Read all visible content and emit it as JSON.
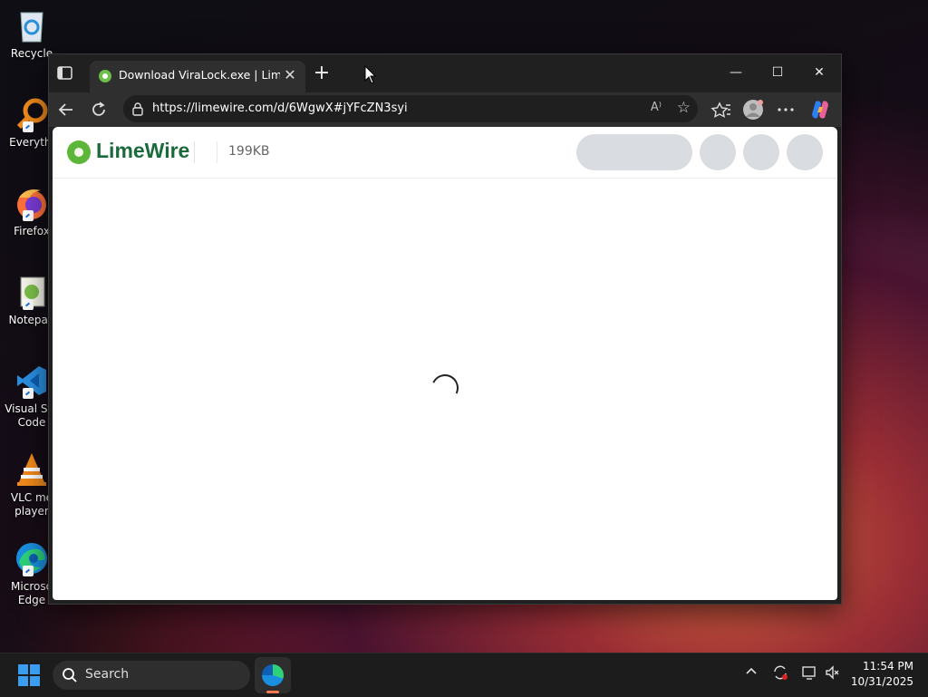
{
  "desktop": {
    "icons": [
      {
        "label": "Recycle",
        "icon": "recycle-bin-icon"
      },
      {
        "label": "Everythi",
        "icon": "everything-search-icon"
      },
      {
        "label": "Firefox",
        "icon": "firefox-icon"
      },
      {
        "label": "Notepad",
        "icon": "notepad-icon"
      },
      {
        "label": "Visual Stu\nCode",
        "label_line1": "Visual Stu",
        "label_line2": "Code",
        "icon": "vscode-icon"
      },
      {
        "label_line1": "VLC me",
        "label_line2": "player",
        "icon": "vlc-icon"
      },
      {
        "label_line1": "Microso",
        "label_line2": "Edge",
        "icon": "edge-icon"
      }
    ]
  },
  "browser": {
    "tab": {
      "title": "Download ViraLock.exe | LimeWire",
      "close": "✕"
    },
    "new_tab": "+",
    "window_controls": {
      "minimize": "—",
      "maximize": "☐",
      "close": "✕"
    },
    "address": {
      "url": "https://limewire.com/d/6WgwX#jYFcZN3syi"
    },
    "read_aloud": "A⁾",
    "favorite": "☆"
  },
  "page": {
    "logo_text": "LimeWire",
    "file_size": "199KB",
    "loading": true
  },
  "taskbar": {
    "search_placeholder": "Search",
    "time": "11:54 PM",
    "date": "10/31/2025"
  },
  "colors": {
    "limewire_green": "#5cb63a",
    "limewire_text": "#1a6a3c",
    "skeleton": "#d9dce0",
    "browser_dark": "#2f2f2f"
  }
}
